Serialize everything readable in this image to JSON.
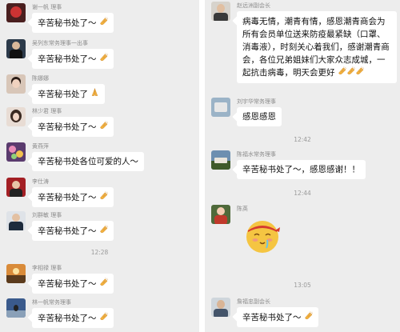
{
  "left": {
    "messages": [
      {
        "sender": "谢一帆 理事",
        "text": "辛苦秘书处了～"
      },
      {
        "sender": "吴列东常务理事一出事",
        "text": "辛苦秘书处了～"
      },
      {
        "sender": "陈娜娜",
        "text": "辛苦秘书处了"
      },
      {
        "sender": "林少君 理事",
        "text": "辛苦秘书处了～"
      },
      {
        "sender": "黄燕萍",
        "text": "辛苦秘书处各位可爱的人～"
      },
      {
        "sender": "李仕涛",
        "text": "辛苦秘书处了～"
      },
      {
        "sender": "刘群敏 理事",
        "text": "辛苦秘书处了～"
      },
      {
        "sender": "李相禄 理事",
        "text": "辛苦秘书处了～"
      },
      {
        "sender": "林一帆常务理事",
        "text": "辛苦秘书处了～"
      }
    ],
    "time_1228": "12:28"
  },
  "right": {
    "m1": {
      "sender": "赵远洲副会长",
      "text": "病毒无情，潮青有情，感恩潮青商会为所有会员单位送来防疫最紧缺（口罩、消毒液），时刻关心着我们，感谢潮青商会，各位兄弟姐妹们大家众志成城，一起抗击病毒，明天会更好"
    },
    "m2": {
      "sender": "刘宇华常务理事",
      "text": "感恩感恩"
    },
    "time_1242": "12:42",
    "m3": {
      "sender": "陈福水常务理事",
      "text": "辛苦秘书处了～，感恩感谢！！"
    },
    "time_1244": "12:44",
    "m4": {
      "sender": "陈英"
    },
    "time_1305": "13:05",
    "m5": {
      "sender": "詹福忠副会长",
      "text": "辛苦秘书处了～"
    }
  },
  "icons": {
    "reaction": "clap-hands-icon",
    "pray": "pray-hands-icon",
    "sticker": "blush-face-sticker"
  },
  "colors": {
    "panel_bg": "#ededed",
    "bubble_bg": "#ffffff",
    "emoji": "#f5c542"
  }
}
